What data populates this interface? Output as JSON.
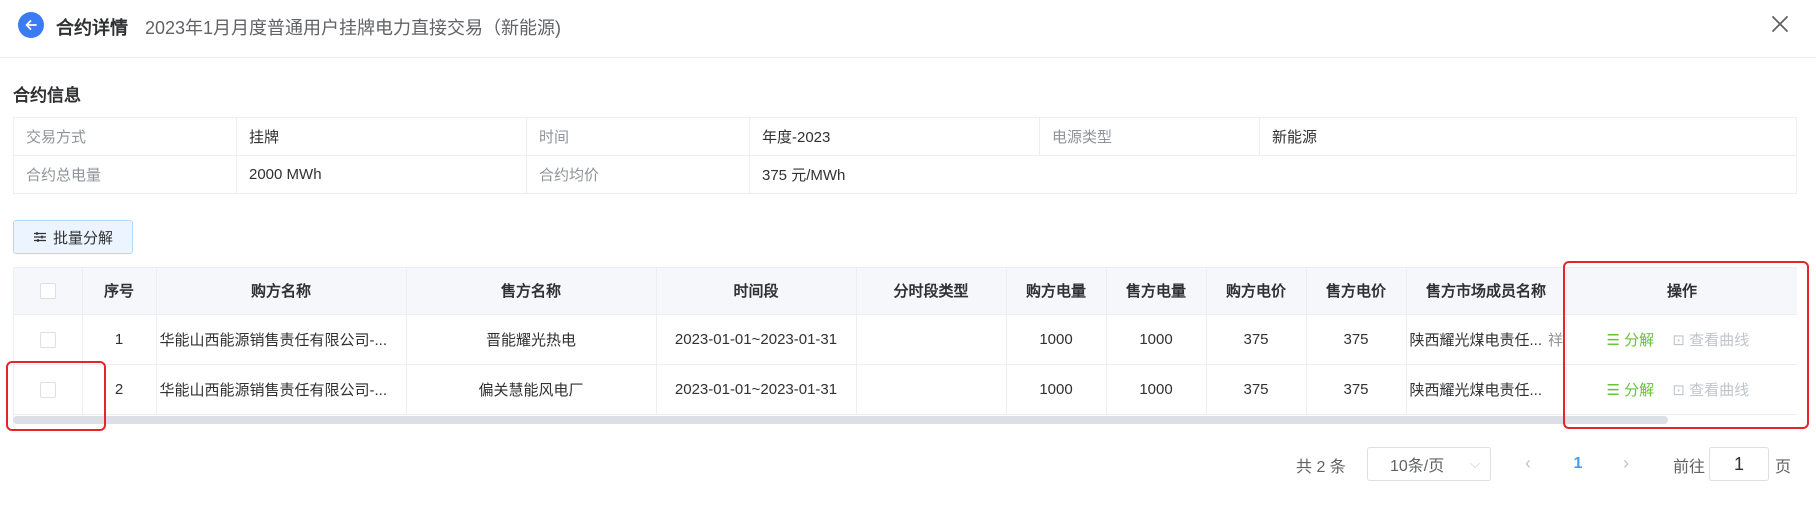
{
  "header": {
    "title": "合约详情",
    "subtitle": "2023年1月月度普通用户挂牌电力直接交易（新能源)"
  },
  "info": {
    "section_title": "合约信息",
    "rows": [
      [
        {
          "label": "交易方式",
          "value": "挂牌"
        },
        {
          "label": "时间",
          "value": "年度-2023"
        },
        {
          "label": "电源类型",
          "value": "新能源"
        }
      ],
      [
        {
          "label": "合约总电量",
          "value": "2000 MWh"
        },
        {
          "label": "合约均价",
          "value": "375 元/MWh"
        }
      ]
    ]
  },
  "toolbar": {
    "batch_label": "批量分解"
  },
  "table": {
    "headers": [
      "序号",
      "购方名称",
      "售方名称",
      "时间段",
      "分时段类型",
      "购方电量",
      "售方电量",
      "购方电价",
      "售方电价",
      "售方市场成员名称",
      "操作"
    ],
    "rows": [
      {
        "index": "1",
        "buyer": "华能山西能源销售责任有限公司-...",
        "seller": "晋能耀光热电",
        "period": "2023-01-01~2023-01-31",
        "tou_type": "",
        "buy_qty": "1000",
        "sell_qty": "1000",
        "buy_price": "375",
        "sell_price": "375",
        "seller_member": "陕西耀光煤电责任...",
        "overflow_char": "祥"
      },
      {
        "index": "2",
        "buyer": "华能山西能源销售责任有限公司-...",
        "seller": "偏关慧能风电厂",
        "period": "2023-01-01~2023-01-31",
        "tou_type": "",
        "buy_qty": "1000",
        "sell_qty": "1000",
        "buy_price": "375",
        "sell_price": "375",
        "seller_member": "陕西耀光煤电责任...",
        "overflow_char": ""
      }
    ],
    "actions": {
      "split": "分解",
      "curve": "查看曲线"
    }
  },
  "pagination": {
    "total": "共 2 条",
    "page_size": "10条/页",
    "current_page": "1",
    "goto_label": "前往",
    "goto_value": "1",
    "page_suffix": "页"
  },
  "colors": {
    "accent": "#409eff",
    "success": "#67c23a",
    "highlight_box": "#e5252a"
  }
}
